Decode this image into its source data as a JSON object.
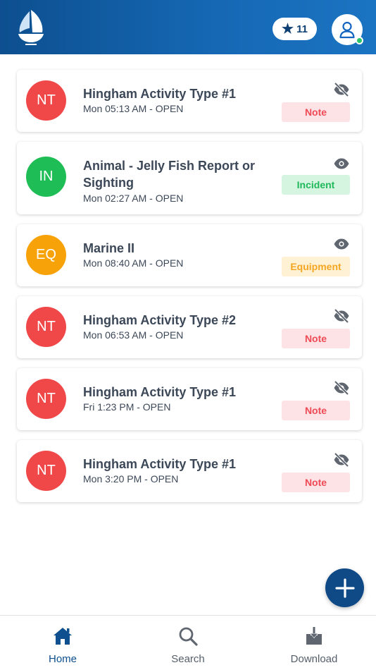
{
  "header": {
    "star_count": "11",
    "colors": {
      "header_start": "#0d4f8f",
      "header_end": "#1b74c2"
    },
    "icons": [
      "app-logo-icon",
      "star-icon",
      "user-icon"
    ]
  },
  "activities": [
    {
      "initials": "NT",
      "title": "Hingham Activity Type #1",
      "subtitle": "Mon 05:13 AM - OPEN",
      "badge": "Note",
      "visibility": "hidden",
      "color": "#f04848"
    },
    {
      "initials": "IN",
      "title": "Animal - Jelly Fish Report or Sighting",
      "subtitle": "Mon 02:27 AM - OPEN",
      "badge": "Incident",
      "visibility": "visible",
      "color": "#1fbd55"
    },
    {
      "initials": "EQ",
      "title": "Marine II",
      "subtitle": "Mon 08:40 AM - OPEN",
      "badge": "Equipment",
      "visibility": "visible",
      "color": "#f8a20a"
    },
    {
      "initials": "NT",
      "title": "Hingham Activity Type #2",
      "subtitle": "Mon 06:53 AM - OPEN",
      "badge": "Note",
      "visibility": "hidden",
      "color": "#f04848"
    },
    {
      "initials": "NT",
      "title": "Hingham Activity Type #1",
      "subtitle": "Fri 1:23 PM - OPEN",
      "badge": "Note",
      "visibility": "hidden",
      "color": "#f04848"
    },
    {
      "initials": "NT",
      "title": "Hingham Activity Type #1",
      "subtitle": "Mon 3:20 PM - OPEN",
      "badge": "Note",
      "visibility": "hidden",
      "color": "#f04848"
    }
  ],
  "badge_colors": {
    "Note": {
      "bg": "#fde3e5",
      "fg": "#ef4a55"
    },
    "Incident": {
      "bg": "#d6f5e1",
      "fg": "#1fb85a"
    },
    "Equipment": {
      "bg": "#fff1d3",
      "fg": "#f5a623"
    }
  },
  "fab": {
    "icon": "plus-icon",
    "color": "#0f4a87"
  },
  "nav": {
    "home": {
      "label": "Home",
      "icon": "home-icon"
    },
    "search": {
      "label": "Search",
      "icon": "search-icon"
    },
    "download": {
      "label": "Download",
      "icon": "download-icon"
    }
  }
}
